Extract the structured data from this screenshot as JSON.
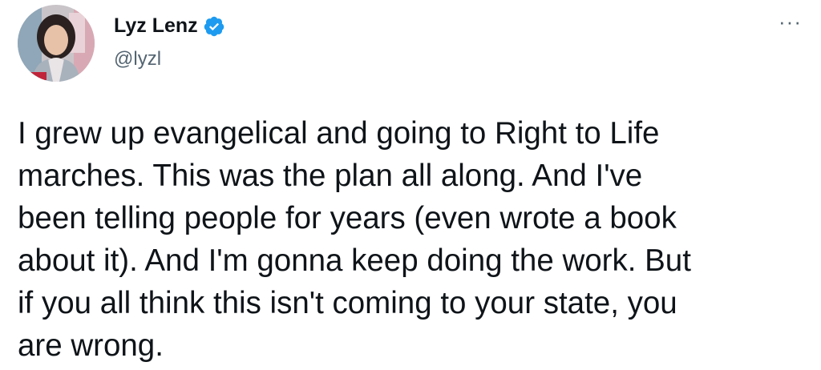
{
  "tweet": {
    "author": {
      "display_name": "Lyz Lenz",
      "handle": "@lyzl",
      "verified": true,
      "avatar_icon": "profile-photo",
      "verified_icon": "verified-badge-icon",
      "verified_color": "#1d9bf0"
    },
    "more_icon": "more-options-icon",
    "more_label": "···",
    "text_lines": [
      "I grew up evangelical and going to Right to Life",
      "marches. This was the plan all along. And I've",
      "been telling people for years (even wrote a book",
      "about it). And I'm gonna keep doing the work. But",
      "if you all think this isn't coming to your state, you",
      "are wrong."
    ]
  }
}
